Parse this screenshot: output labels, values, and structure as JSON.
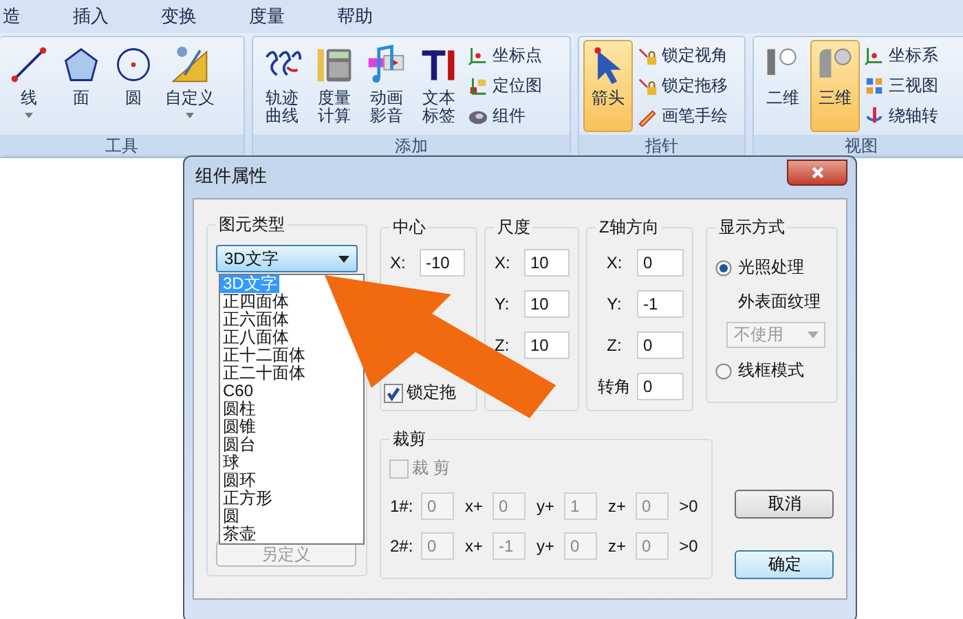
{
  "menu": [
    "造",
    "插入",
    "变换",
    "度量",
    "帮助"
  ],
  "ribbon": [
    {
      "label": "工具",
      "large": [
        {
          "lines": [
            "线"
          ],
          "dropdown": true,
          "selected": false
        },
        {
          "lines": [
            "面"
          ],
          "dropdown": false,
          "selected": false
        },
        {
          "lines": [
            "圆"
          ],
          "dropdown": false,
          "selected": false
        },
        {
          "lines": [
            "自定义"
          ],
          "dropdown": true,
          "selected": false
        }
      ]
    },
    {
      "label": "添加",
      "large": [
        {
          "lines": [
            "轨迹",
            "曲线"
          ],
          "dropdown": false,
          "selected": false
        },
        {
          "lines": [
            "度量",
            "计算"
          ],
          "dropdown": false,
          "selected": false
        },
        {
          "lines": [
            "动画",
            "影音"
          ],
          "dropdown": false,
          "selected": false
        },
        {
          "lines": [
            "文本",
            "标签"
          ],
          "dropdown": false,
          "selected": false
        }
      ],
      "small": [
        "坐标点",
        "定位图",
        "组件"
      ]
    },
    {
      "label": "指针",
      "large": [
        {
          "lines": [
            "箭头"
          ],
          "dropdown": false,
          "selected": true
        }
      ],
      "small": [
        "锁定视角",
        "锁定拖移",
        "画笔手绘"
      ]
    },
    {
      "label": "视图",
      "large": [
        {
          "lines": [
            "二维"
          ],
          "dropdown": false,
          "selected": false
        },
        {
          "lines": [
            "三维"
          ],
          "dropdown": false,
          "selected": true
        }
      ],
      "small": [
        "坐标系",
        "三视图",
        "绕轴转"
      ]
    }
  ],
  "dialog": {
    "title": "组件属性",
    "element_type": {
      "label": "图元类型",
      "value": "3D文字",
      "options": [
        {
          "label": "3D文字",
          "selected": true
        },
        {
          "label": "正四面体",
          "selected": false
        },
        {
          "label": "正六面体",
          "selected": false
        },
        {
          "label": "正八面体",
          "selected": false
        },
        {
          "label": "正十二面体",
          "selected": false
        },
        {
          "label": "正二十面体",
          "selected": false
        },
        {
          "label": "C60",
          "selected": false
        },
        {
          "label": "圆柱",
          "selected": false
        },
        {
          "label": "圆锥",
          "selected": false
        },
        {
          "label": "圆台",
          "selected": false
        },
        {
          "label": "球",
          "selected": false
        },
        {
          "label": "圆环",
          "selected": false
        },
        {
          "label": "正方形",
          "selected": false
        },
        {
          "label": "圆",
          "selected": false
        },
        {
          "label": "茶壶",
          "selected": false
        }
      ],
      "define_button": {
        "label": "另定义",
        "disabled": true
      }
    },
    "center": {
      "label": "中心",
      "fields": [
        {
          "label": "X:",
          "value": "-10"
        }
      ],
      "lock": {
        "label": "锁定拖",
        "checked": true
      }
    },
    "scale": {
      "label": "尺度",
      "fields": [
        {
          "label": "X:",
          "value": "10"
        },
        {
          "label": "Y:",
          "value": "10"
        },
        {
          "label": "Z:",
          "value": "10"
        }
      ]
    },
    "z_axis": {
      "label": "Z轴方向",
      "fields": [
        {
          "label": "X:",
          "value": "0"
        },
        {
          "label": "Y:",
          "value": "-1"
        },
        {
          "label": "Z:",
          "value": "0"
        },
        {
          "label": "转角",
          "value": "0"
        }
      ]
    },
    "display": {
      "label": "显示方式",
      "options": [
        {
          "label": "光照处理",
          "selected": true
        },
        {
          "label": "线框模式",
          "selected": false
        }
      ],
      "texture": {
        "label": "外表面纹理",
        "value": "不使用",
        "disabled": true
      }
    },
    "clip": {
      "label": "裁剪",
      "checkbox": {
        "label": "裁 剪",
        "checked": false,
        "disabled": true
      },
      "rows": [
        {
          "label": "1#:",
          "terms": [
            {
              "value": "0",
              "suffix": "x+"
            },
            {
              "value": "0",
              "suffix": "y+"
            },
            {
              "value": "1",
              "suffix": "z+"
            },
            {
              "value": "0",
              "suffix": ">0"
            }
          ]
        },
        {
          "label": "2#:",
          "terms": [
            {
              "value": "0",
              "suffix": "x+"
            },
            {
              "value": "-1",
              "suffix": "y+"
            },
            {
              "value": "0",
              "suffix": "z+"
            },
            {
              "value": "0",
              "suffix": ">0"
            }
          ]
        }
      ]
    },
    "buttons": [
      {
        "label": "取消",
        "default": false
      },
      {
        "label": "确定",
        "default": true
      }
    ]
  }
}
